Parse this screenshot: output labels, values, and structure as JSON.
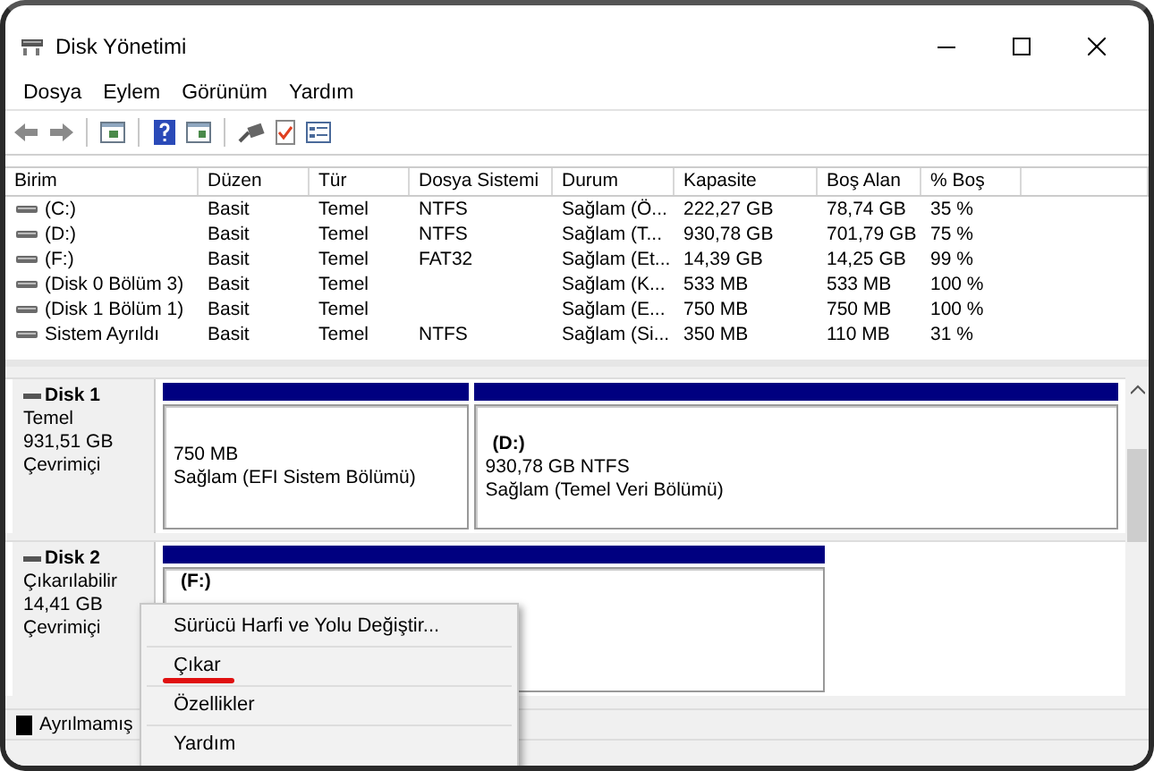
{
  "window": {
    "title": "Disk Yönetimi"
  },
  "menu": [
    "Dosya",
    "Eylem",
    "Görünüm",
    "Yardım"
  ],
  "volumes": {
    "columns": [
      "Birim",
      "Düzen",
      "Tür",
      "Dosya Sistemi",
      "Durum",
      "Kapasite",
      "Boş Alan",
      "% Boş"
    ],
    "rows": [
      {
        "cells": [
          "(C:)",
          "Basit",
          "Temel",
          "NTFS",
          "Sağlam (Ö...",
          "222,27 GB",
          "78,74 GB",
          "35 %"
        ]
      },
      {
        "cells": [
          "(D:)",
          "Basit",
          "Temel",
          "NTFS",
          "Sağlam (T...",
          "930,78 GB",
          "701,79 GB",
          "75 %"
        ]
      },
      {
        "cells": [
          "(F:)",
          "Basit",
          "Temel",
          "FAT32",
          "Sağlam (Et...",
          "14,39 GB",
          "14,25 GB",
          "99 %"
        ]
      },
      {
        "cells": [
          "(Disk 0 Bölüm 3)",
          "Basit",
          "Temel",
          "",
          "Sağlam (K...",
          "533 MB",
          "533 MB",
          "100 %"
        ]
      },
      {
        "cells": [
          "(Disk 1 Bölüm 1)",
          "Basit",
          "Temel",
          "",
          "Sağlam (E...",
          "750 MB",
          "750 MB",
          "100 %"
        ]
      },
      {
        "cells": [
          "Sistem Ayrıldı",
          "Basit",
          "Temel",
          "NTFS",
          "Sağlam (Si...",
          "350 MB",
          "110 MB",
          "31 %"
        ]
      }
    ]
  },
  "disks": [
    {
      "name": "Disk 1",
      "lines": [
        "Temel",
        "931,51 GB",
        "Çevrimiçi"
      ],
      "partitions": [
        {
          "lines": [
            "750 MB",
            "Sağlam (EFI Sistem Bölümü)"
          ]
        },
        {
          "title": "(D:)",
          "lines": [
            "930,78 GB NTFS",
            "Sağlam (Temel Veri Bölümü)"
          ]
        }
      ]
    },
    {
      "name": "Disk 2",
      "lines": [
        "Çıkarılabilir",
        "14,41 GB",
        "Çevrimiçi"
      ],
      "partitions": [
        {
          "title": "(F:)"
        }
      ]
    }
  ],
  "legend": [
    {
      "label": "Ayrılmamış",
      "color": "#000000"
    }
  ],
  "context_menu": [
    {
      "label": "Sürücü Harfi ve Yolu Değiştir...",
      "marked": false
    },
    {
      "label": "Çıkar",
      "marked": true
    },
    {
      "label": "Özellikler",
      "marked": false
    },
    {
      "label": "Yardım",
      "marked": false
    }
  ]
}
